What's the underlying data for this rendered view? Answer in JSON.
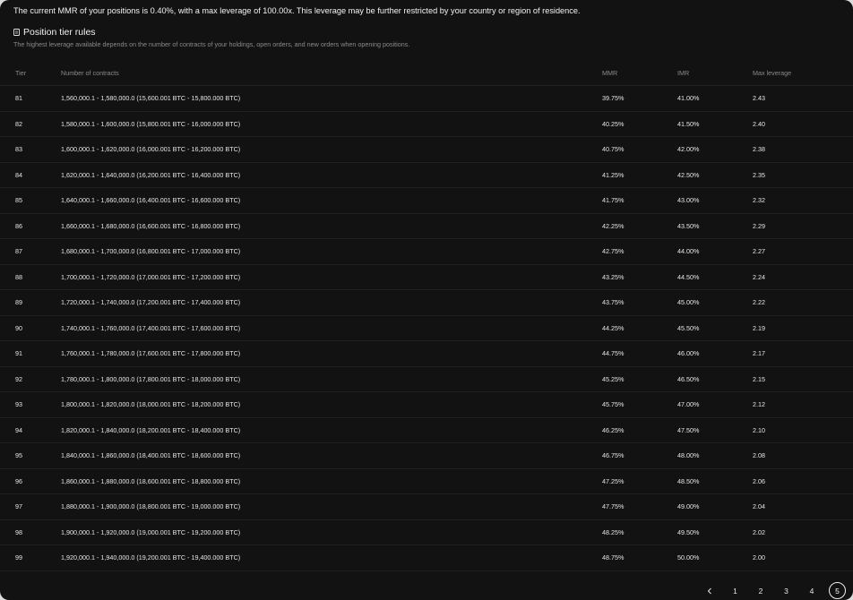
{
  "notice": "The current MMR of your positions is 0.40%, with a max leverage of 100.00x. This leverage may be further restricted by your country or region of residence.",
  "section": {
    "title": "Position tier rules",
    "description": "The highest leverage available depends on the number of contracts of your holdings, open orders, and new orders when opening positions.",
    "icon": "document-icon"
  },
  "table": {
    "headers": {
      "tier": "Tier",
      "contracts": "Number of contracts",
      "mmr": "MMR",
      "imr": "IMR",
      "max_leverage": "Max leverage"
    },
    "rows": [
      {
        "tier": "81",
        "contracts": "1,560,000.1 - 1,580,000.0 (15,600.001 BTC - 15,800.000 BTC)",
        "mmr": "39.75%",
        "imr": "41.00%",
        "max_leverage": "2.43"
      },
      {
        "tier": "82",
        "contracts": "1,580,000.1 - 1,600,000.0 (15,800.001 BTC - 16,000.000 BTC)",
        "mmr": "40.25%",
        "imr": "41.50%",
        "max_leverage": "2.40"
      },
      {
        "tier": "83",
        "contracts": "1,600,000.1 - 1,620,000.0 (16,000.001 BTC - 16,200.000 BTC)",
        "mmr": "40.75%",
        "imr": "42.00%",
        "max_leverage": "2.38"
      },
      {
        "tier": "84",
        "contracts": "1,620,000.1 - 1,640,000.0 (16,200.001 BTC - 16,400.000 BTC)",
        "mmr": "41.25%",
        "imr": "42.50%",
        "max_leverage": "2.35"
      },
      {
        "tier": "85",
        "contracts": "1,640,000.1 - 1,660,000.0 (16,400.001 BTC - 16,600.000 BTC)",
        "mmr": "41.75%",
        "imr": "43.00%",
        "max_leverage": "2.32"
      },
      {
        "tier": "86",
        "contracts": "1,660,000.1 - 1,680,000.0 (16,600.001 BTC - 16,800.000 BTC)",
        "mmr": "42.25%",
        "imr": "43.50%",
        "max_leverage": "2.29"
      },
      {
        "tier": "87",
        "contracts": "1,680,000.1 - 1,700,000.0 (16,800.001 BTC - 17,000.000 BTC)",
        "mmr": "42.75%",
        "imr": "44.00%",
        "max_leverage": "2.27"
      },
      {
        "tier": "88",
        "contracts": "1,700,000.1 - 1,720,000.0 (17,000.001 BTC - 17,200.000 BTC)",
        "mmr": "43.25%",
        "imr": "44.50%",
        "max_leverage": "2.24"
      },
      {
        "tier": "89",
        "contracts": "1,720,000.1 - 1,740,000.0 (17,200.001 BTC - 17,400.000 BTC)",
        "mmr": "43.75%",
        "imr": "45.00%",
        "max_leverage": "2.22"
      },
      {
        "tier": "90",
        "contracts": "1,740,000.1 - 1,760,000.0 (17,400.001 BTC - 17,600.000 BTC)",
        "mmr": "44.25%",
        "imr": "45.50%",
        "max_leverage": "2.19"
      },
      {
        "tier": "91",
        "contracts": "1,760,000.1 - 1,780,000.0 (17,600.001 BTC - 17,800.000 BTC)",
        "mmr": "44.75%",
        "imr": "46.00%",
        "max_leverage": "2.17"
      },
      {
        "tier": "92",
        "contracts": "1,780,000.1 - 1,800,000.0 (17,800.001 BTC - 18,000.000 BTC)",
        "mmr": "45.25%",
        "imr": "46.50%",
        "max_leverage": "2.15"
      },
      {
        "tier": "93",
        "contracts": "1,800,000.1 - 1,820,000.0 (18,000.001 BTC - 18,200.000 BTC)",
        "mmr": "45.75%",
        "imr": "47.00%",
        "max_leverage": "2.12"
      },
      {
        "tier": "94",
        "contracts": "1,820,000.1 - 1,840,000.0 (18,200.001 BTC - 18,400.000 BTC)",
        "mmr": "46.25%",
        "imr": "47.50%",
        "max_leverage": "2.10"
      },
      {
        "tier": "95",
        "contracts": "1,840,000.1 - 1,860,000.0 (18,400.001 BTC - 18,600.000 BTC)",
        "mmr": "46.75%",
        "imr": "48.00%",
        "max_leverage": "2.08"
      },
      {
        "tier": "96",
        "contracts": "1,860,000.1 - 1,880,000.0 (18,600.001 BTC - 18,800.000 BTC)",
        "mmr": "47.25%",
        "imr": "48.50%",
        "max_leverage": "2.06"
      },
      {
        "tier": "97",
        "contracts": "1,880,000.1 - 1,900,000.0 (18,800.001 BTC - 19,000.000 BTC)",
        "mmr": "47.75%",
        "imr": "49.00%",
        "max_leverage": "2.04"
      },
      {
        "tier": "98",
        "contracts": "1,900,000.1 - 1,920,000.0 (19,000.001 BTC - 19,200.000 BTC)",
        "mmr": "48.25%",
        "imr": "49.50%",
        "max_leverage": "2.02"
      },
      {
        "tier": "99",
        "contracts": "1,920,000.1 - 1,940,000.0 (19,200.001 BTC - 19,400.000 BTC)",
        "mmr": "48.75%",
        "imr": "50.00%",
        "max_leverage": "2.00"
      }
    ]
  },
  "pagination": {
    "prev_icon": "chevron-left-icon",
    "pages": [
      "1",
      "2",
      "3",
      "4",
      "5"
    ],
    "current": "5"
  },
  "colors": {
    "background": "#121212",
    "text": "#e6e6e6",
    "muted": "#8a8a8a",
    "divider": "#202020"
  }
}
